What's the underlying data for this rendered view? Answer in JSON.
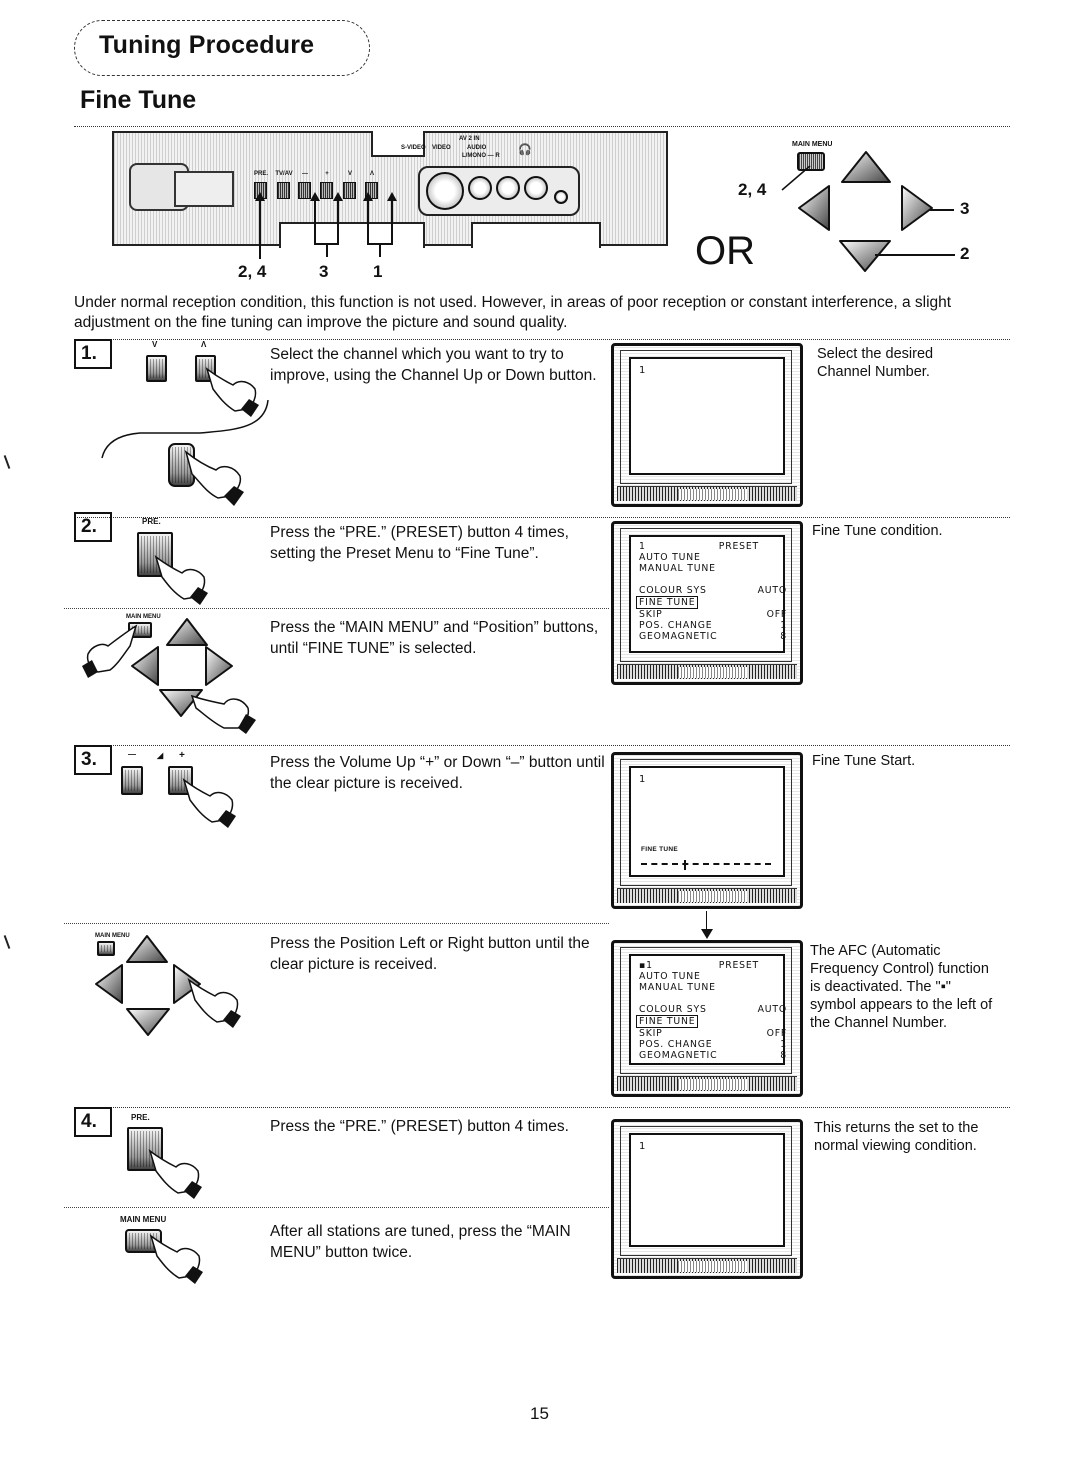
{
  "header": {
    "section_title": "Tuning Procedure",
    "page_title": "Fine Tune"
  },
  "control_panel": {
    "buttons": [
      {
        "id": "pre",
        "label": "PRE."
      },
      {
        "id": "tv_av",
        "label": "TV/AV"
      },
      {
        "id": "vol_down",
        "label": "—"
      },
      {
        "id": "vol_up",
        "label": "+"
      },
      {
        "id": "ch_down",
        "label": "V"
      },
      {
        "id": "ch_up",
        "label": "Λ"
      }
    ],
    "jack_labels": {
      "av_in": "AV 2 IN",
      "svideo": "S-VIDEO",
      "video": "VIDEO",
      "audio": "AUDIO",
      "mono": "L/MONO — R"
    },
    "callouts": {
      "pre": "2, 4",
      "volume": "3",
      "channel": "1"
    }
  },
  "remote": {
    "main_menu_label": "MAIN MENU",
    "or_label": "OR",
    "callouts": {
      "main_menu": "2, 4",
      "right": "3",
      "down": "2"
    }
  },
  "intro_text": "Under normal reception condition, this function is not used. However, in areas of poor reception or constant interference, a slight adjustment on the fine tuning can improve the picture and sound quality.",
  "steps": [
    {
      "number": "1.",
      "button_labels": [
        "V",
        "Λ"
      ],
      "instruction": "Select the channel which you want to try to improve, using the Channel Up or Down button.",
      "screen": {
        "channel": "1"
      },
      "note": "Select the desired Channel Number."
    },
    {
      "number": "2.",
      "button_label": "PRE.",
      "instruction": "Press the “PRE.” (PRESET) button 4 times, setting the Preset Menu to “Fine Tune”.",
      "sub_button_label": "MAIN MENU",
      "sub_instruction": "Press the “MAIN MENU” and “Position” buttons, until “FINE TUNE” is selected.",
      "screen": {
        "menu": [
          {
            "label": "1",
            "value": "PRESET"
          },
          {
            "label": "AUTO TUNE",
            "value": ""
          },
          {
            "label": "MANUAL TUNE",
            "value": ""
          },
          {
            "label": "",
            "value": ""
          },
          {
            "label": "COLOUR SYS",
            "value": "AUTO"
          },
          {
            "label": "FINE TUNE",
            "value": "",
            "selected": true
          },
          {
            "label": "SKIP",
            "value": "OFF"
          },
          {
            "label": "POS. CHANGE",
            "value": "1"
          },
          {
            "label": "GEOMAGNETIC",
            "value": "8"
          }
        ]
      },
      "note": "Fine Tune condition."
    },
    {
      "number": "3.",
      "button_labels": [
        "—",
        "◢",
        "+"
      ],
      "instruction": "Press the Volume Up “+” or Down “–” button until the clear picture is received.",
      "screen": {
        "channel": "1",
        "fine_tune_label": "FINE TUNE",
        "fine_tune_position": 0.33
      },
      "note": "Fine Tune Start.",
      "sub_button_label": "MAIN MENU",
      "sub_instruction": "Press the Position Left or Right  button until the clear picture is received.",
      "sub_screen": {
        "menu": [
          {
            "label": "▪1",
            "value": "PRESET"
          },
          {
            "label": "AUTO TUNE",
            "value": ""
          },
          {
            "label": "MANUAL TUNE",
            "value": ""
          },
          {
            "label": "",
            "value": ""
          },
          {
            "label": "COLOUR SYS",
            "value": "AUTO"
          },
          {
            "label": "FINE TUNE",
            "value": "",
            "selected": true
          },
          {
            "label": "SKIP",
            "value": "OFF"
          },
          {
            "label": "POS. CHANGE",
            "value": "1"
          },
          {
            "label": "GEOMAGNETIC",
            "value": "8"
          }
        ]
      },
      "sub_note": "The AFC (Automatic Frequency Control) function is deactivated. The \"▪\" symbol appears to the left of the Channel Number."
    },
    {
      "number": "4.",
      "button_label": "PRE.",
      "instruction": "Press the “PRE.” (PRESET) button 4 times.",
      "sub_button_label": "MAIN MENU",
      "sub_instruction": "After all stations are tuned, press the “MAIN MENU” button twice.",
      "screen": {
        "channel": "1"
      },
      "note": "This returns the set to the normal viewing condition."
    }
  ],
  "page_number": "15"
}
